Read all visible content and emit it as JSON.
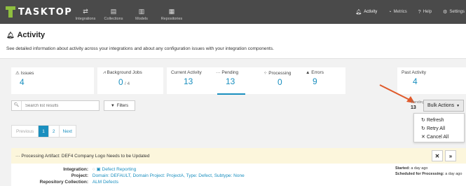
{
  "app": {
    "logo_text": "TASKTOP"
  },
  "nav": {
    "items": [
      {
        "label": "Integrations",
        "icon": "integrations-icon"
      },
      {
        "label": "Collections",
        "icon": "collections-icon"
      },
      {
        "label": "Models",
        "icon": "models-icon"
      },
      {
        "label": "Repositories",
        "icon": "repositories-icon"
      }
    ],
    "right": [
      {
        "label": "Activity",
        "icon": "bell-icon",
        "active": true
      },
      {
        "label": "Metrics",
        "icon": "metrics-icon"
      },
      {
        "label": "Help",
        "icon": "help-icon"
      },
      {
        "label": "Settings",
        "icon": "gear-icon"
      }
    ]
  },
  "header": {
    "title": "Activity",
    "subtitle": "See detailed information about activity across your integrations and about any configuration issues with your integration components."
  },
  "stats": {
    "issues": {
      "label": "Issues",
      "value": "4"
    },
    "background_jobs": {
      "label": "Background Jobs",
      "value": "0",
      "total": "/ 4"
    },
    "current_activity": {
      "label": "Current Activity",
      "value": "13"
    },
    "pending": {
      "label": "Pending",
      "value": "13"
    },
    "processing": {
      "label": "Processing",
      "value": "0"
    },
    "errors": {
      "label": "Errors",
      "value": "9"
    },
    "past_activity": {
      "label": "Past Activity",
      "value": "4"
    }
  },
  "toolbar": {
    "search_placeholder": "Search list results",
    "filters_label": "Filters",
    "count_label": "Pending",
    "count": "13",
    "bulk_label": "Bulk Actions"
  },
  "bulk_menu": [
    {
      "label": "Refresh",
      "icon": "refresh-icon",
      "glyph": "↻"
    },
    {
      "label": "Retry All",
      "icon": "retry-icon",
      "glyph": "↻"
    },
    {
      "label": "Cancel All",
      "icon": "close-icon",
      "glyph": "✕"
    }
  ],
  "pagination": {
    "previous": "Previous",
    "pages": [
      "1",
      "2"
    ],
    "current": "1",
    "next": "Next"
  },
  "processing_row": {
    "text": "Processing Artifact: DEF4 Company Logo Needs to be Updated"
  },
  "details": {
    "integration_label": "Integration:",
    "integration_value": "Defect Reporting",
    "project_label": "Project:",
    "project_value": "Domain: DEFAULT, Domain Project: ProjectA, Type: Defect, Subtype: None",
    "repo_label": "Repository Collection:",
    "repo_value": "ALM Defects",
    "started_label": "Started:",
    "started_value": "a day ago",
    "scheduled_label": "Scheduled for Processing:",
    "scheduled_value": "a day ago"
  },
  "colors": {
    "navbar": "#4a4a4a",
    "accent": "#1a8fbf",
    "logo_green": "#8fbf3f",
    "arrow": "#e05a2b",
    "pending_bg": "#fcf6dc"
  }
}
